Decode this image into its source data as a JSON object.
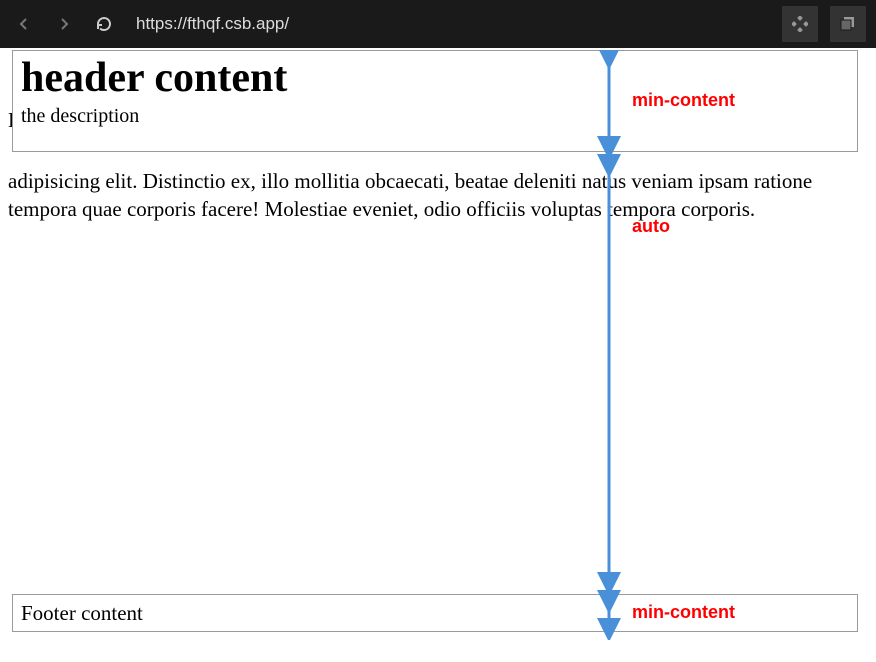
{
  "browser": {
    "url": "https://fthqf.csb.app/"
  },
  "header": {
    "title": "header content",
    "description": "the description"
  },
  "main": {
    "p1": "Lorem ipsum dolor sit, amet consectetur",
    "p2": "adipisicing elit. Distinctio ex, illo mollitia obcaecati, beatae deleniti natus veniam ipsam ratione tempora quae corporis facere! Molestiae eveniet, odio officiis voluptas tempora corporis."
  },
  "footer": {
    "text": "Footer content"
  },
  "annotations": {
    "headerLabel": "min-content",
    "mainLabel": "auto",
    "footerLabel": "min-content"
  },
  "colors": {
    "annotation": "#ff0000",
    "arrow": "#4a90d9"
  }
}
